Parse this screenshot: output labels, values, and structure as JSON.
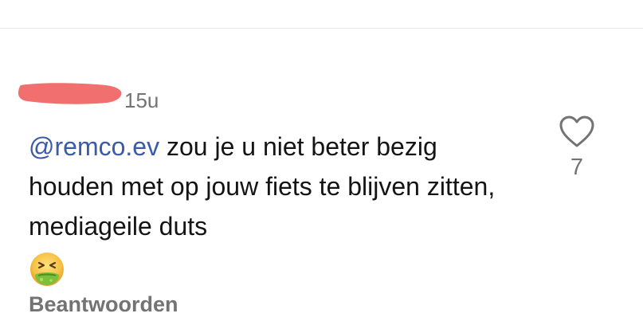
{
  "comment": {
    "timestamp": "15u",
    "mention": "@remco.ev",
    "text_rest": " zou je u niet beter bezig houden met op jouw fiets te blijven zitten, mediageile duts",
    "emoji": "nauseated-face",
    "reply_label": "Beantwoorden",
    "like_count": "7",
    "colors": {
      "mention": "#3a5ba8",
      "redaction": "#f16f6f",
      "muted": "#737373"
    },
    "icons": [
      "heart-outline-icon",
      "nauseated-face-emoji"
    ]
  }
}
